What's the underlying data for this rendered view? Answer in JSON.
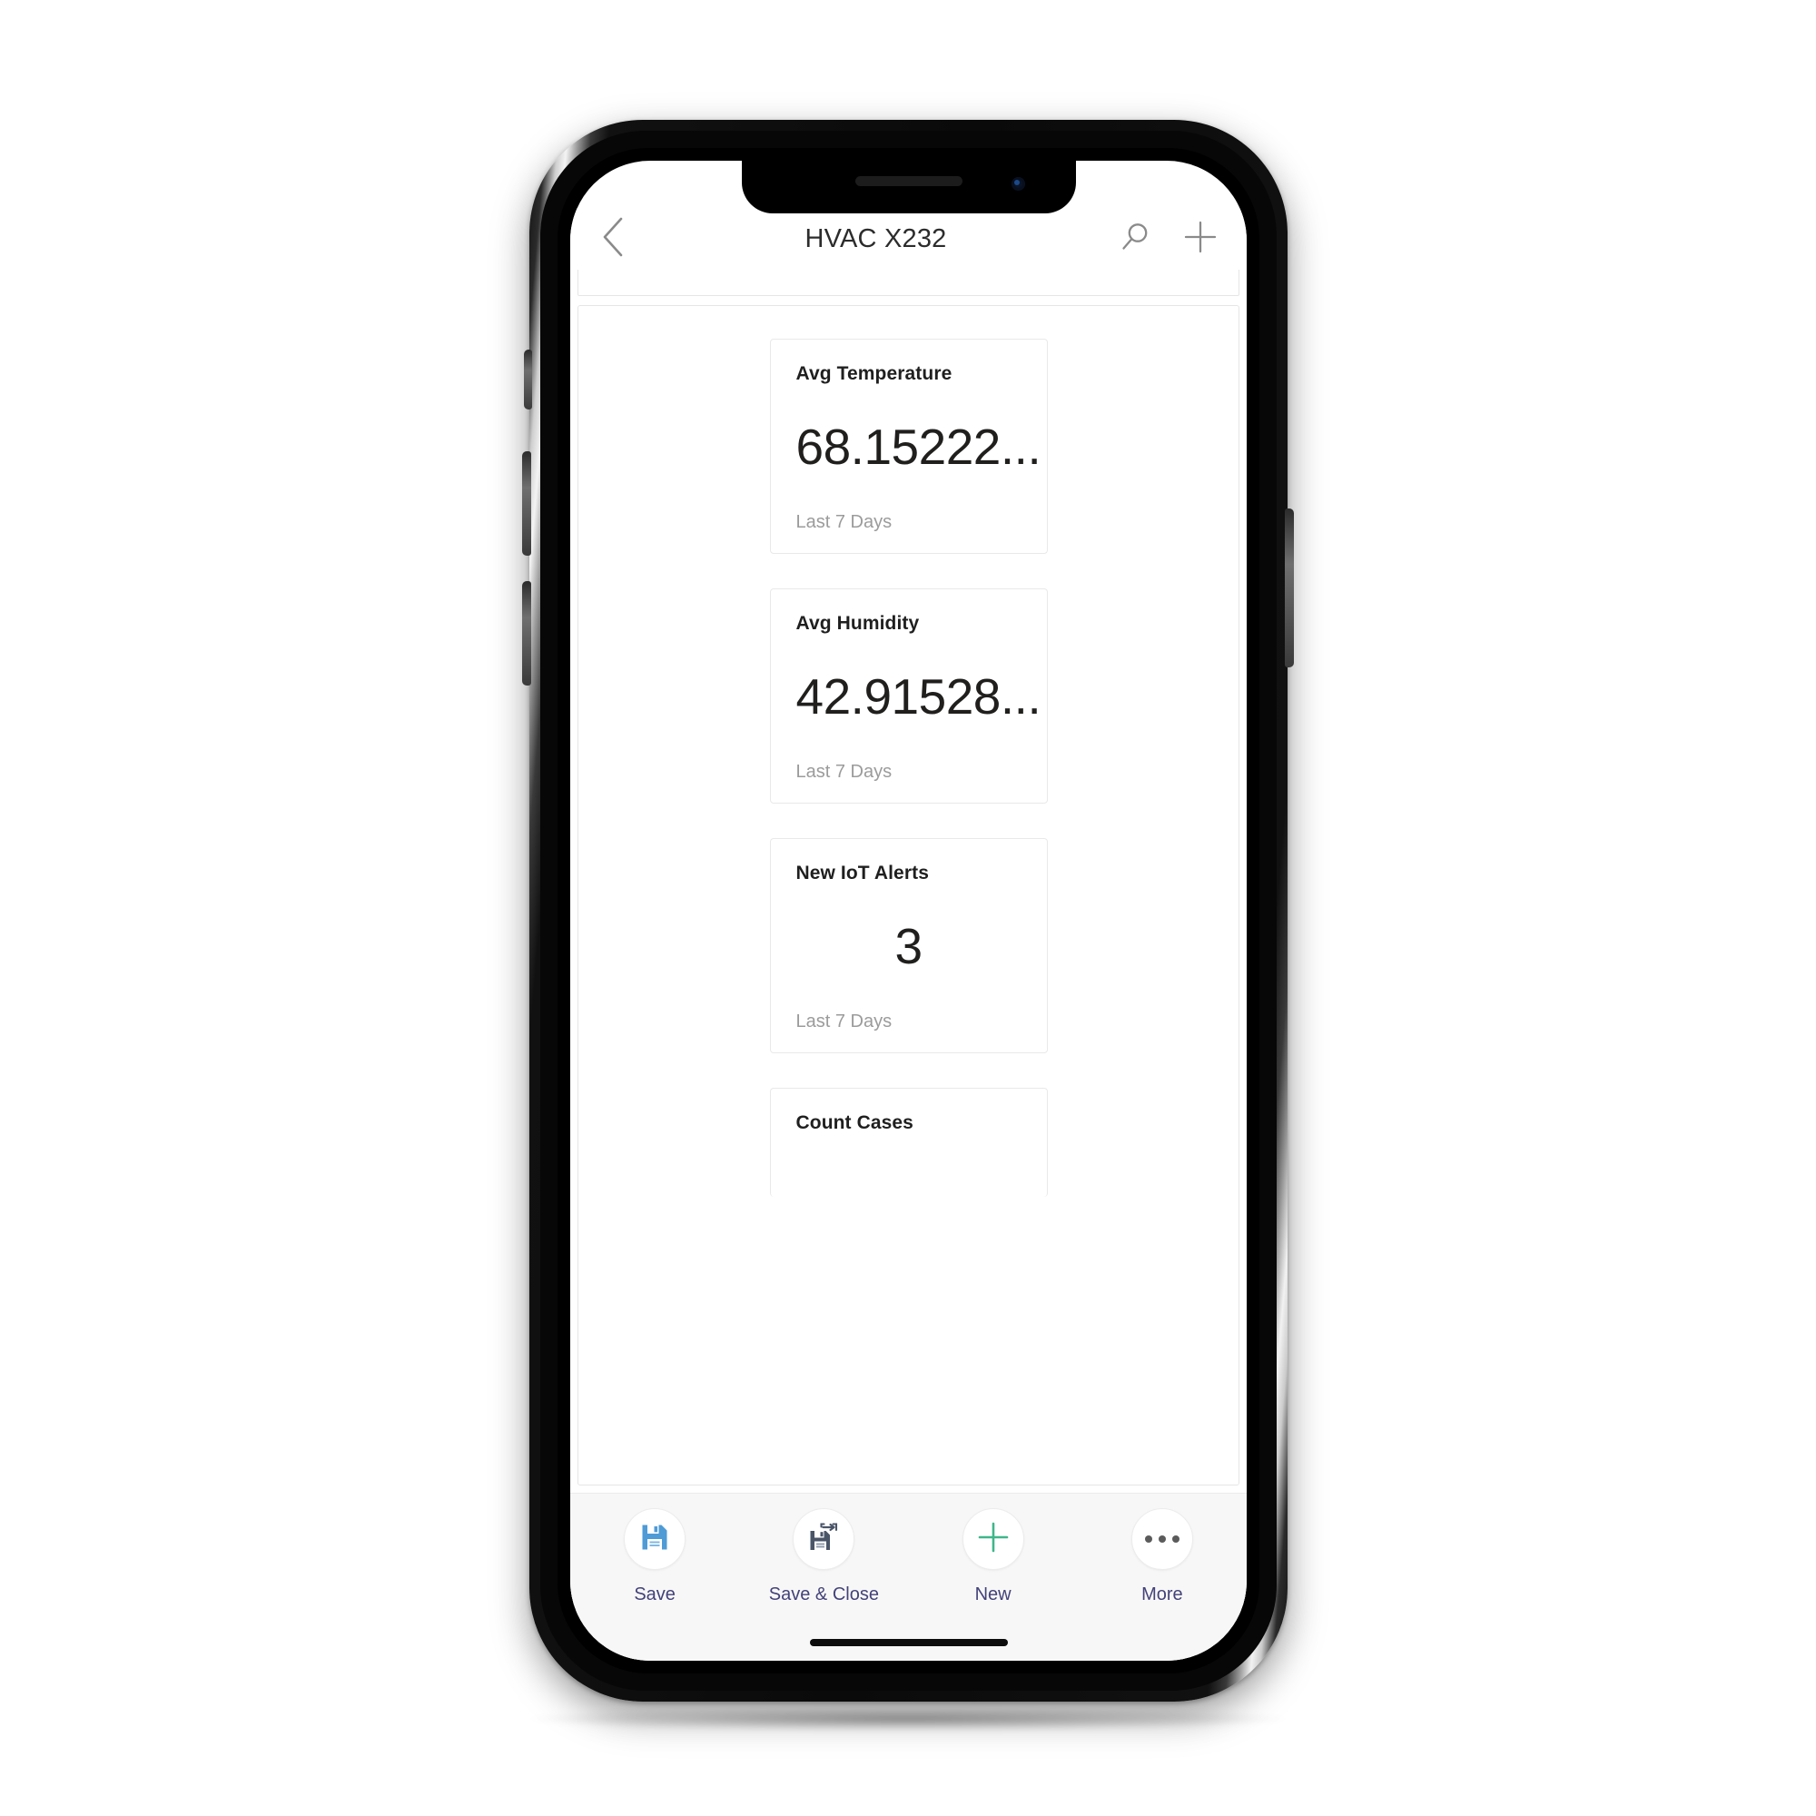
{
  "navbar": {
    "back_icon": "chevron-left-icon",
    "title": "HVAC X232",
    "search_icon": "search-icon",
    "add_icon": "plus-icon"
  },
  "cards": [
    {
      "title": "Avg Temperature",
      "value": "68.15222...",
      "footer": "Last 7 Days",
      "align": "left"
    },
    {
      "title": "Avg Humidity",
      "value": "42.91528...",
      "footer": "Last 7 Days",
      "align": "left"
    },
    {
      "title": "New IoT Alerts",
      "value": "3",
      "footer": "Last 7 Days",
      "align": "center"
    },
    {
      "title": "Count Cases",
      "value": "",
      "footer": "",
      "align": "left"
    }
  ],
  "commandbar": {
    "items": [
      {
        "label": "Save",
        "icon": "save-icon"
      },
      {
        "label": "Save & Close",
        "icon": "save-and-close-icon"
      },
      {
        "label": "New",
        "icon": "plus-icon"
      },
      {
        "label": "More",
        "icon": "ellipsis-icon"
      }
    ]
  },
  "colors": {
    "accent_blue": "#3a96dd",
    "accent_green": "#3fb68b",
    "label_text": "#43427a",
    "title_text": "#2c2c2c",
    "muted_text": "#9b9b9b"
  }
}
